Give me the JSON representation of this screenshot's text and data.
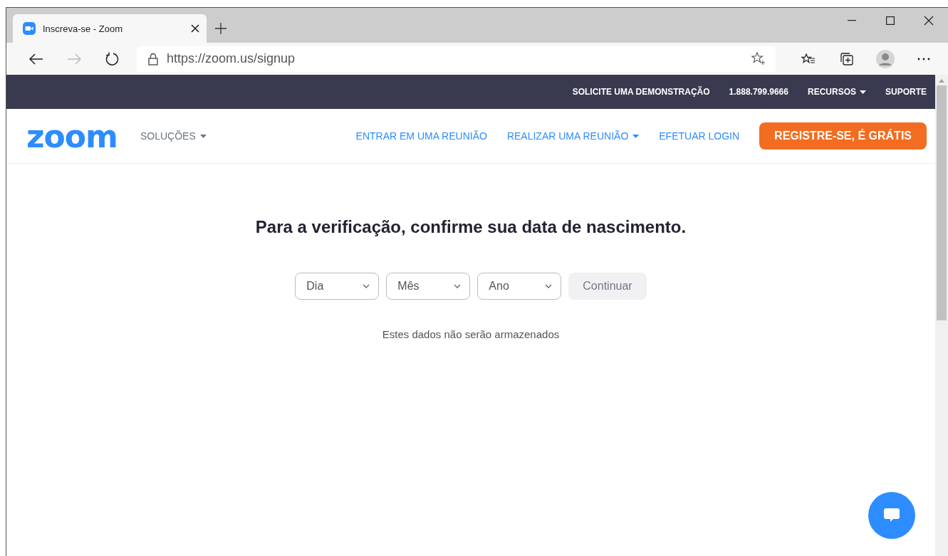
{
  "browser": {
    "tab": {
      "title": "Inscreva-se - Zoom",
      "selected": true
    },
    "url": "https://zoom.us/signup"
  },
  "top_bar": {
    "links": [
      {
        "label": "SOLICITE UMA DEMONSTRAÇÃO",
        "dropdown": false
      },
      {
        "label": "1.888.799.9666",
        "dropdown": false
      },
      {
        "label": "RECURSOS",
        "dropdown": true
      },
      {
        "label": "SUPORTE",
        "dropdown": false
      }
    ]
  },
  "nav": {
    "logo": "zoom",
    "solutions": {
      "label": "SOLUÇÕES",
      "dropdown": true
    },
    "links": [
      {
        "label": "ENTRAR EM UMA REUNIÃO",
        "dropdown": false
      },
      {
        "label": "REALIZAR UMA REUNIÃO",
        "dropdown": true
      },
      {
        "label": "EFETUAR LOGIN",
        "dropdown": false
      }
    ],
    "cta": "REGISTRE-SE, É GRÁTIS"
  },
  "main": {
    "heading": "Para a verificação, confirme sua data de nascimento.",
    "selects": [
      {
        "placeholder": "Dia"
      },
      {
        "placeholder": "Mês"
      },
      {
        "placeholder": "Ano"
      }
    ],
    "continue": {
      "label": "Continuar",
      "disabled": true
    },
    "note": "Estes dados não serão armazenados"
  }
}
